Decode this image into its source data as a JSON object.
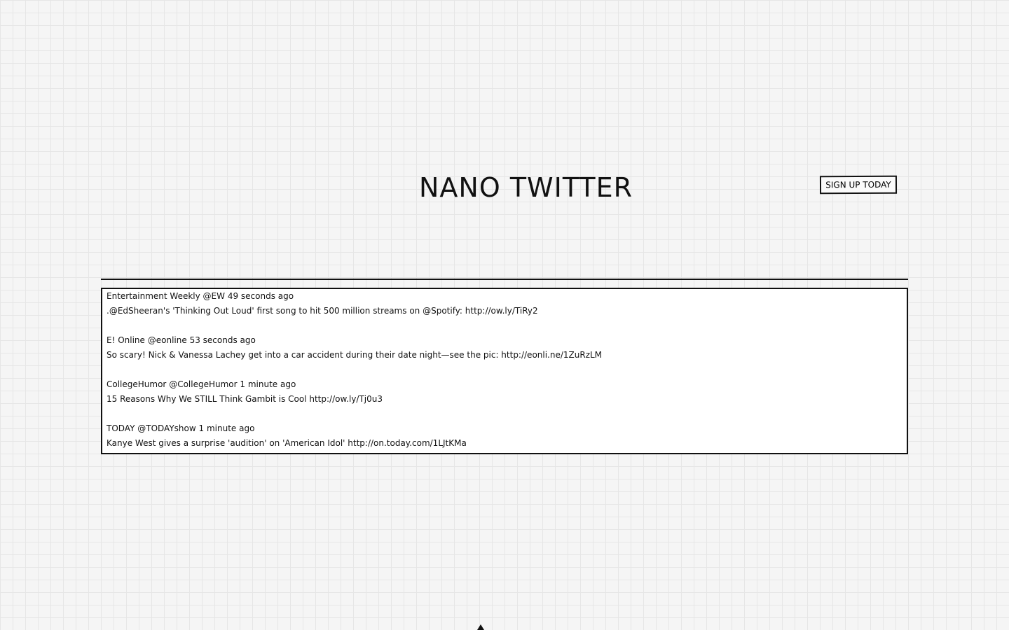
{
  "header": {
    "title": "NANO TWITTER",
    "signup_label": "SIGN UP TODAY"
  },
  "feed": {
    "tweets": [
      {
        "name": "Entertainment Weekly",
        "handle": "@EW",
        "time": "49 seconds ago",
        "text": ".@EdSheeran's 'Thinking Out Loud' first song to hit 500 million streams on @Spotify: http://ow.ly/TiRy2"
      },
      {
        "name": "E! Online",
        "handle": "@eonline",
        "time": "53 seconds ago",
        "text": "So scary! Nick & Vanessa Lachey get into a car accident during their date night—see the pic: http://eonli.ne/1ZuRzLM"
      },
      {
        "name": "CollegeHumor",
        "handle": "@CollegeHumor",
        "time": "1 minute ago",
        "text": "15 Reasons Why We STILL Think Gambit is Cool http://ow.ly/Tj0u3"
      },
      {
        "name": "TODAY",
        "handle": "@TODAYshow",
        "time": "1 minute ago",
        "text": "Kanye West gives a surprise 'audition' on 'American Idol' http://on.today.com/1LJtKMa"
      }
    ]
  }
}
